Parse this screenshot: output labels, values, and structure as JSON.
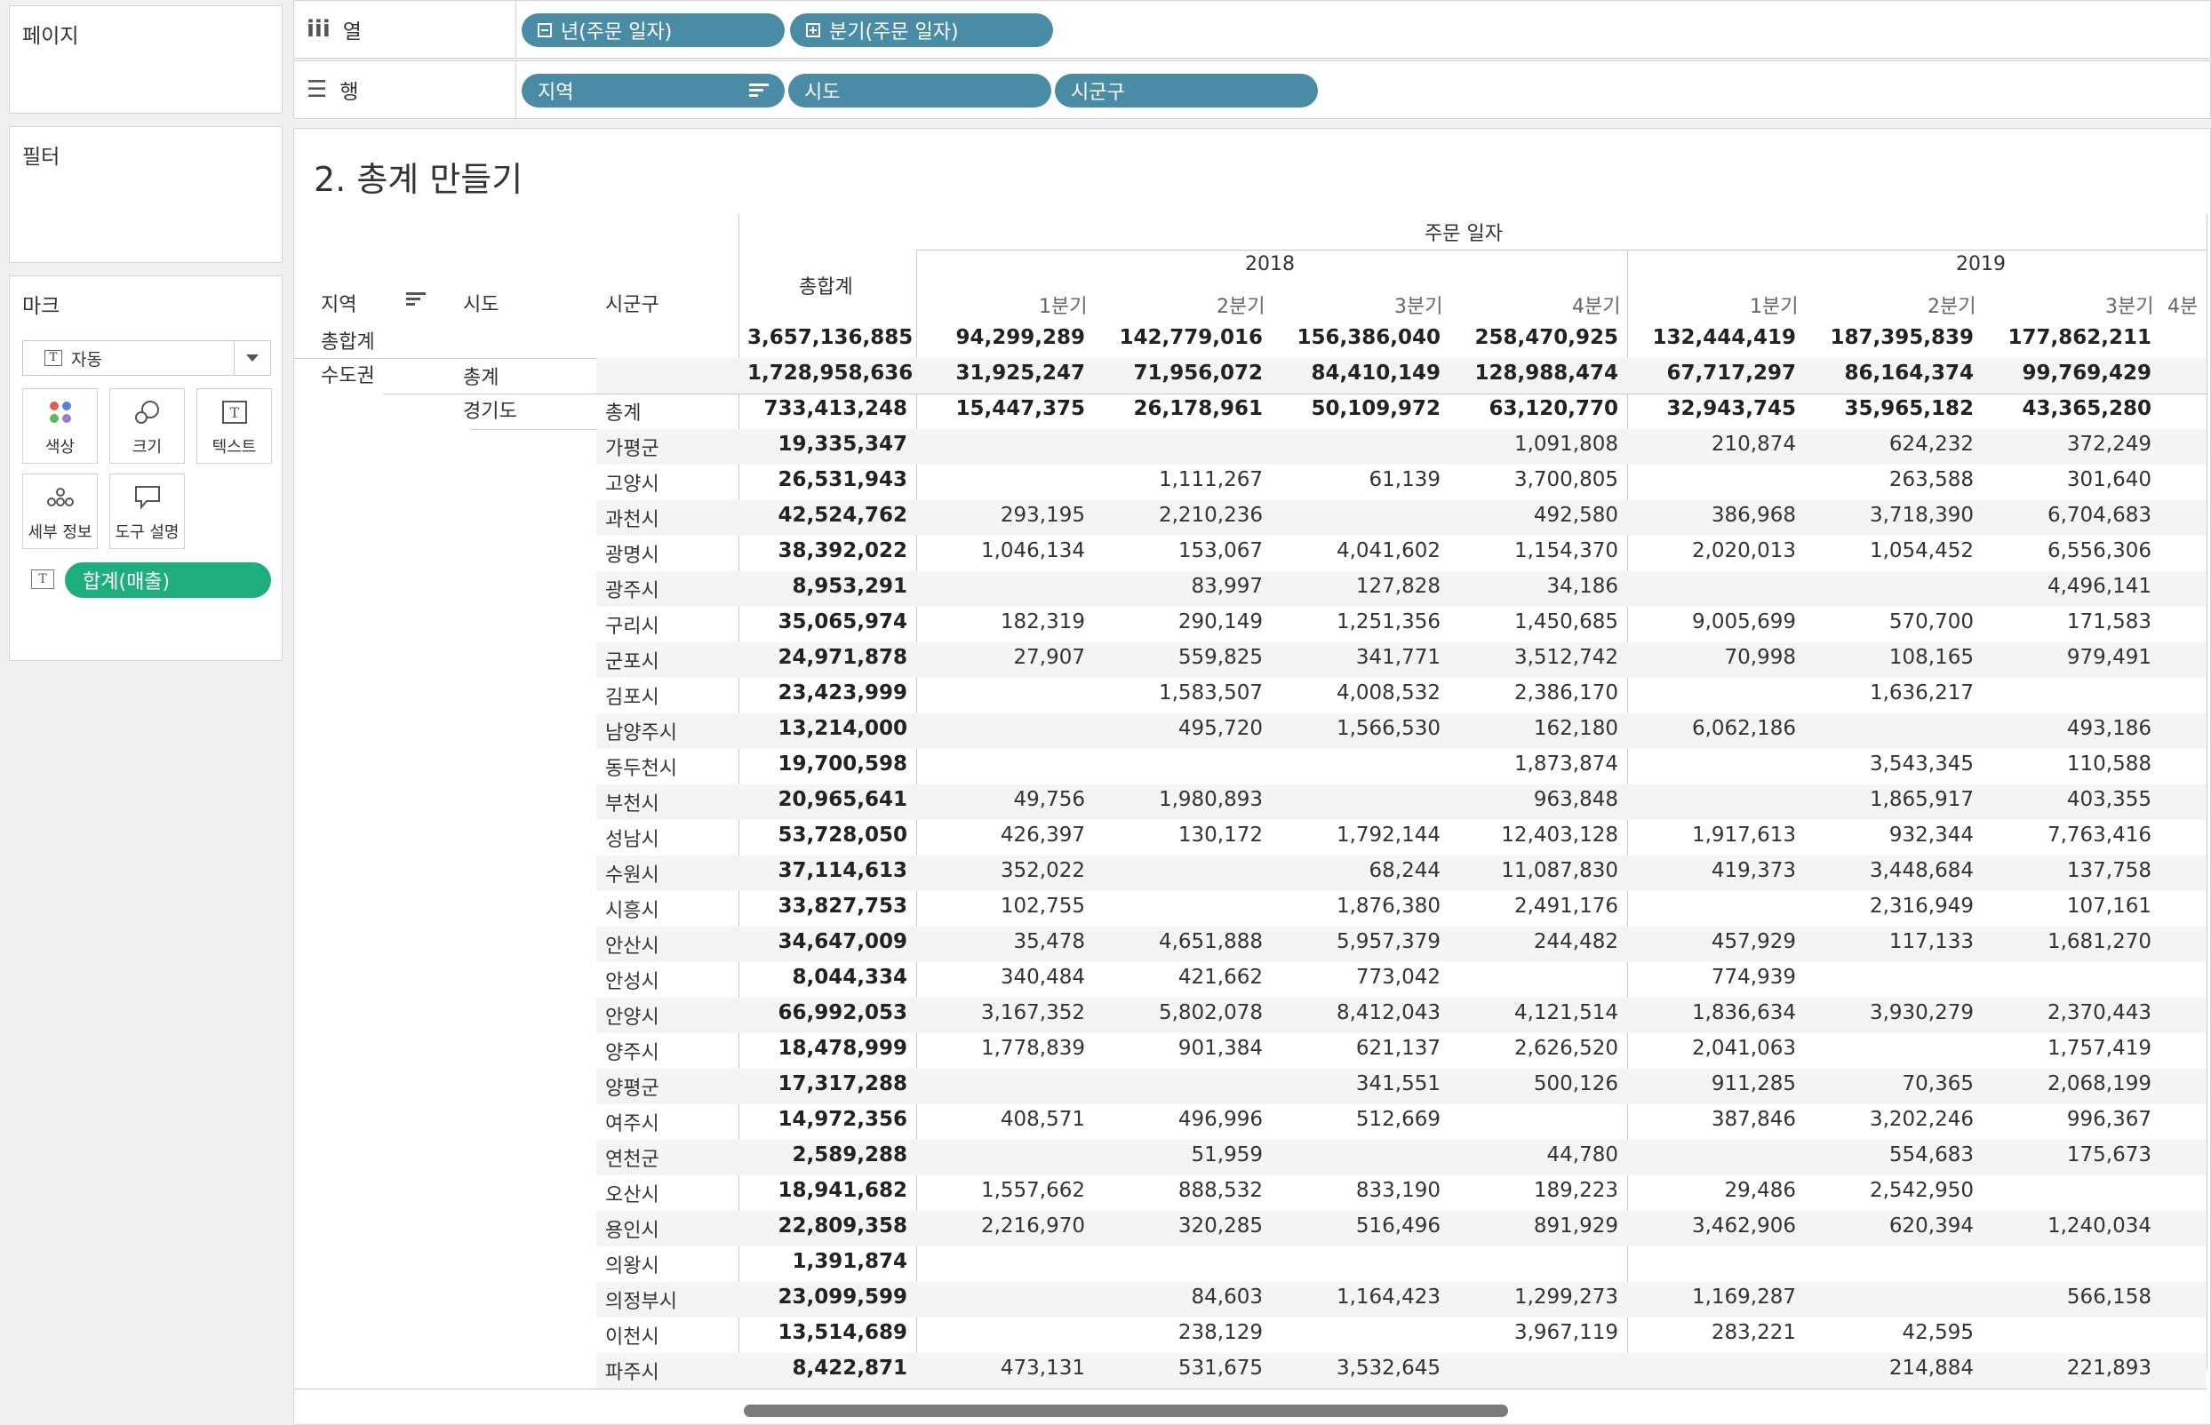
{
  "pages_panel": {
    "title": "페이지"
  },
  "filters_panel": {
    "title": "필터"
  },
  "marks_panel": {
    "title": "마크",
    "mark_type": "자동",
    "buttons": [
      "색상",
      "크기",
      "텍스트",
      "세부 정보",
      "도구 설명"
    ],
    "measure_pill": "합계(매출)"
  },
  "columns_shelf": {
    "label": "열",
    "pills": [
      "년(주문 일자)",
      "분기(주문 일자)"
    ]
  },
  "rows_shelf": {
    "label": "행",
    "pills": [
      "지역",
      "시도",
      "시군구"
    ]
  },
  "view": {
    "title": "2. 총계 만들기",
    "col_headers": {
      "region": "지역",
      "province": "시도",
      "city": "시군구",
      "grand_total": "총합계",
      "order_date": "주문 일자"
    },
    "years": [
      "2018",
      "2019"
    ],
    "quarters": [
      "1분기",
      "2분기",
      "3분기",
      "4분기",
      "1분기",
      "2분기",
      "3분기",
      "4분"
    ],
    "row_labels": {
      "grand_total": "총합계",
      "region": "수도권",
      "subtotal": "총계",
      "province": "경기도",
      "province_total": "총계"
    }
  },
  "table": {
    "rows": [
      {
        "label": "총합계",
        "total": "3,657,136,885",
        "values": [
          "94,299,289",
          "142,779,016",
          "156,386,040",
          "258,470,925",
          "132,444,419",
          "187,395,839",
          "177,862,211"
        ]
      },
      {
        "label": "총계",
        "total": "1,728,958,636",
        "values": [
          "31,925,247",
          "71,956,072",
          "84,410,149",
          "128,988,474",
          "67,717,297",
          "86,164,374",
          "99,769,429"
        ]
      },
      {
        "label": "총계",
        "total": "733,413,248",
        "values": [
          "15,447,375",
          "26,178,961",
          "50,109,972",
          "63,120,770",
          "32,943,745",
          "35,965,182",
          "43,365,280"
        ]
      },
      {
        "label": "가평군",
        "total": "19,335,347",
        "values": [
          "",
          "",
          "",
          "1,091,808",
          "210,874",
          "624,232",
          "372,249"
        ]
      },
      {
        "label": "고양시",
        "total": "26,531,943",
        "values": [
          "",
          "1,111,267",
          "61,139",
          "3,700,805",
          "",
          "263,588",
          "301,640"
        ]
      },
      {
        "label": "과천시",
        "total": "42,524,762",
        "values": [
          "293,195",
          "2,210,236",
          "",
          "492,580",
          "386,968",
          "3,718,390",
          "6,704,683"
        ]
      },
      {
        "label": "광명시",
        "total": "38,392,022",
        "values": [
          "1,046,134",
          "153,067",
          "4,041,602",
          "1,154,370",
          "2,020,013",
          "1,054,452",
          "6,556,306"
        ]
      },
      {
        "label": "광주시",
        "total": "8,953,291",
        "values": [
          "",
          "83,997",
          "127,828",
          "34,186",
          "",
          "",
          "4,496,141"
        ]
      },
      {
        "label": "구리시",
        "total": "35,065,974",
        "values": [
          "182,319",
          "290,149",
          "1,251,356",
          "1,450,685",
          "9,005,699",
          "570,700",
          "171,583"
        ]
      },
      {
        "label": "군포시",
        "total": "24,971,878",
        "values": [
          "27,907",
          "559,825",
          "341,771",
          "3,512,742",
          "70,998",
          "108,165",
          "979,491"
        ]
      },
      {
        "label": "김포시",
        "total": "23,423,999",
        "values": [
          "",
          "1,583,507",
          "4,008,532",
          "2,386,170",
          "",
          "1,636,217",
          ""
        ]
      },
      {
        "label": "남양주시",
        "total": "13,214,000",
        "values": [
          "",
          "495,720",
          "1,566,530",
          "162,180",
          "6,062,186",
          "",
          "493,186"
        ]
      },
      {
        "label": "동두천시",
        "total": "19,700,598",
        "values": [
          "",
          "",
          "",
          "1,873,874",
          "",
          "3,543,345",
          "110,588"
        ]
      },
      {
        "label": "부천시",
        "total": "20,965,641",
        "values": [
          "49,756",
          "1,980,893",
          "",
          "963,848",
          "",
          "1,865,917",
          "403,355"
        ]
      },
      {
        "label": "성남시",
        "total": "53,728,050",
        "values": [
          "426,397",
          "130,172",
          "1,792,144",
          "12,403,128",
          "1,917,613",
          "932,344",
          "7,763,416"
        ]
      },
      {
        "label": "수원시",
        "total": "37,114,613",
        "values": [
          "352,022",
          "",
          "68,244",
          "11,087,830",
          "419,373",
          "3,448,684",
          "137,758"
        ]
      },
      {
        "label": "시흥시",
        "total": "33,827,753",
        "values": [
          "102,755",
          "",
          "1,876,380",
          "2,491,176",
          "",
          "2,316,949",
          "107,161"
        ]
      },
      {
        "label": "안산시",
        "total": "34,647,009",
        "values": [
          "35,478",
          "4,651,888",
          "5,957,379",
          "244,482",
          "457,929",
          "117,133",
          "1,681,270"
        ]
      },
      {
        "label": "안성시",
        "total": "8,044,334",
        "values": [
          "340,484",
          "421,662",
          "773,042",
          "",
          "774,939",
          "",
          ""
        ]
      },
      {
        "label": "안양시",
        "total": "66,992,053",
        "values": [
          "3,167,352",
          "5,802,078",
          "8,412,043",
          "4,121,514",
          "1,836,634",
          "3,930,279",
          "2,370,443"
        ]
      },
      {
        "label": "양주시",
        "total": "18,478,999",
        "values": [
          "1,778,839",
          "901,384",
          "621,137",
          "2,626,520",
          "2,041,063",
          "",
          "1,757,419"
        ]
      },
      {
        "label": "양평군",
        "total": "17,317,288",
        "values": [
          "",
          "",
          "341,551",
          "500,126",
          "911,285",
          "70,365",
          "2,068,199"
        ]
      },
      {
        "label": "여주시",
        "total": "14,972,356",
        "values": [
          "408,571",
          "496,996",
          "512,669",
          "",
          "387,846",
          "3,202,246",
          "996,367"
        ]
      },
      {
        "label": "연천군",
        "total": "2,589,288",
        "values": [
          "",
          "51,959",
          "",
          "44,780",
          "",
          "554,683",
          "175,673"
        ]
      },
      {
        "label": "오산시",
        "total": "18,941,682",
        "values": [
          "1,557,662",
          "888,532",
          "833,190",
          "189,223",
          "29,486",
          "2,542,950",
          ""
        ]
      },
      {
        "label": "용인시",
        "total": "22,809,358",
        "values": [
          "2,216,970",
          "320,285",
          "516,496",
          "891,929",
          "3,462,906",
          "620,394",
          "1,240,034"
        ]
      },
      {
        "label": "의왕시",
        "total": "1,391,874",
        "values": [
          "",
          "",
          "",
          "",
          "",
          "",
          ""
        ]
      },
      {
        "label": "의정부시",
        "total": "23,099,599",
        "values": [
          "",
          "84,603",
          "1,164,423",
          "1,299,273",
          "1,169,287",
          "",
          "566,158"
        ]
      },
      {
        "label": "이천시",
        "total": "13,514,689",
        "values": [
          "",
          "238,129",
          "",
          "3,967,119",
          "283,221",
          "42,595",
          ""
        ]
      },
      {
        "label": "파주시",
        "total": "8,422,871",
        "values": [
          "473,131",
          "531,675",
          "3,532,645",
          "",
          "",
          "214,884",
          "221,893"
        ]
      }
    ]
  }
}
